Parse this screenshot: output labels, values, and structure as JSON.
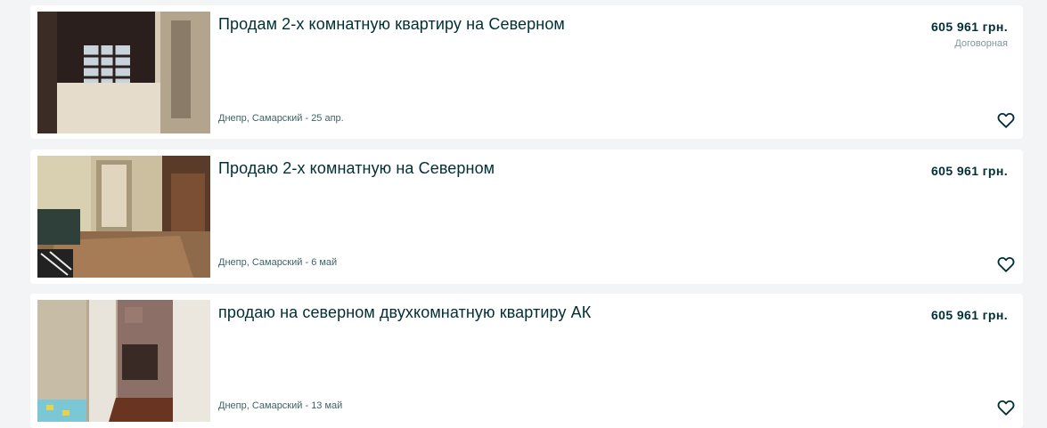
{
  "listings": [
    {
      "title": "Продам 2-х комнатную квартиру на Северном",
      "location": "Днепр, Самарский - 25 апр.",
      "price": "605 961 грн.",
      "note": "Договорная",
      "photo_icon": "apartment-photo"
    },
    {
      "title": "Продаю 2-х комнатную на Северном",
      "location": "Днепр, Самарский - 6 май",
      "price": "605 961 грн.",
      "note": "",
      "photo_icon": "apartment-photo"
    },
    {
      "title": "продаю на северном двухкомнатную квартиру АК",
      "location": "Днепр, Самарский - 13 май",
      "price": "605 961 грн.",
      "note": "",
      "photo_icon": "apartment-photo"
    }
  ],
  "favorite_icon": "heart-outline-icon",
  "colors": {
    "page_background": "#f2f4f5",
    "card_background": "#ffffff",
    "text_primary": "#002f34",
    "text_secondary": "#406367",
    "text_muted": "#7f9799"
  }
}
